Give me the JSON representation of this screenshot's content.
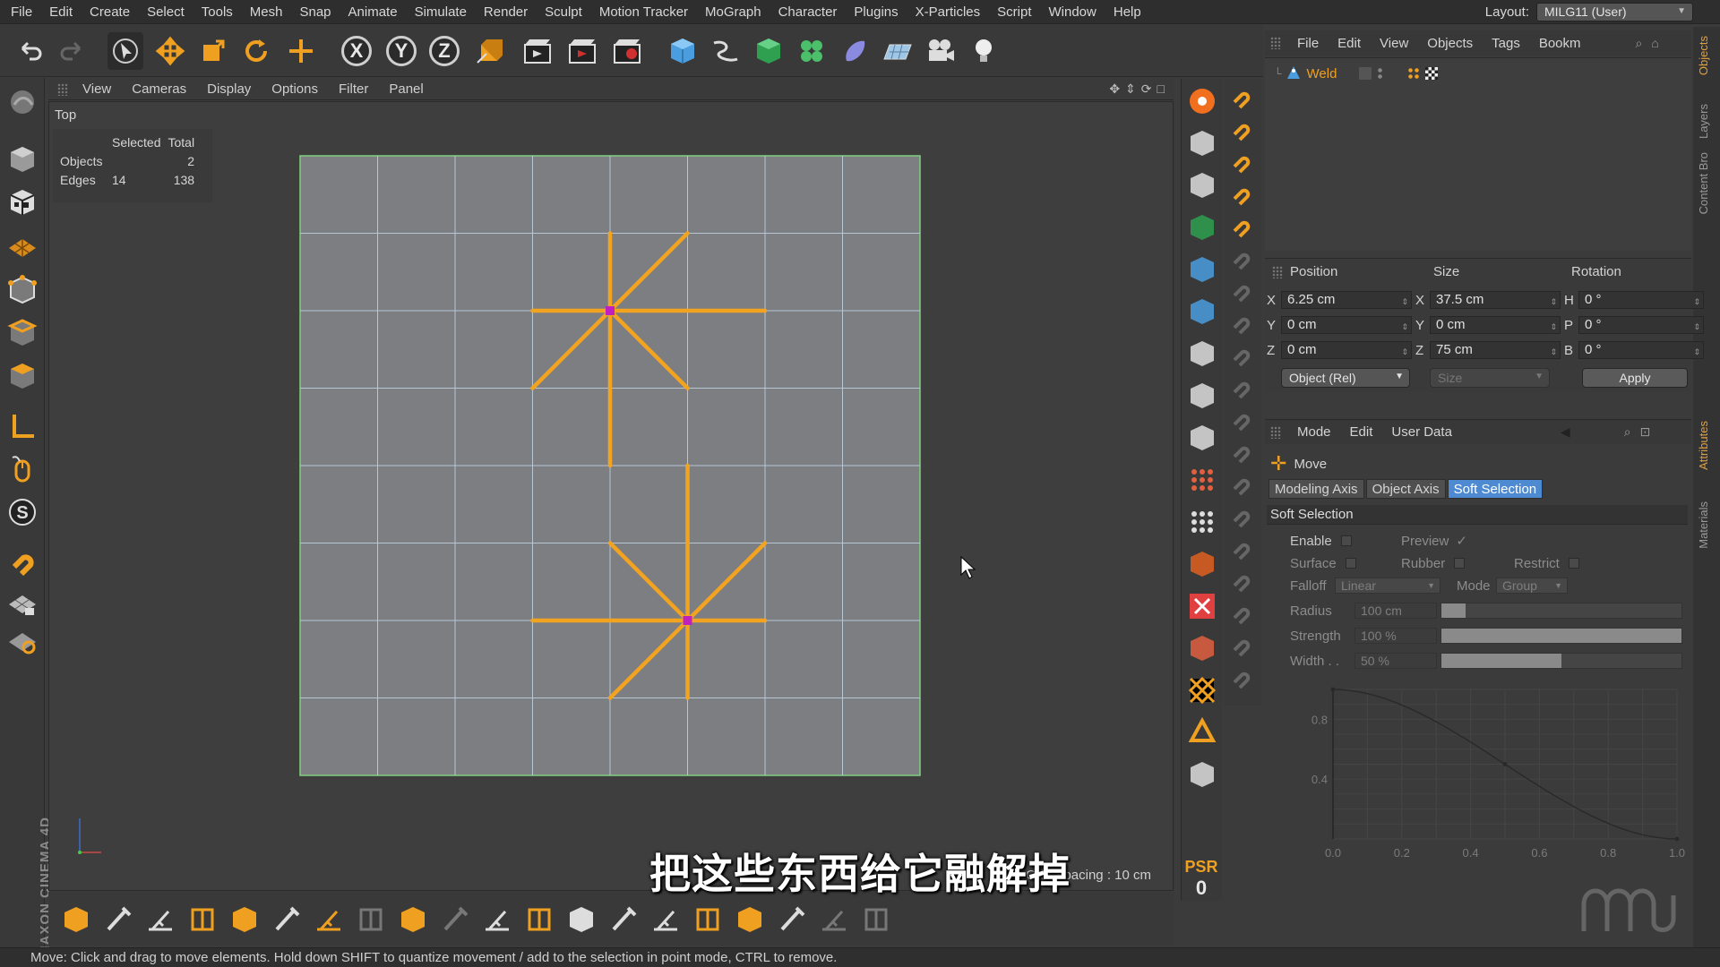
{
  "menubar": {
    "items": [
      "File",
      "Edit",
      "Create",
      "Select",
      "Tools",
      "Mesh",
      "Snap",
      "Animate",
      "Simulate",
      "Render",
      "Sculpt",
      "Motion Tracker",
      "MoGraph",
      "Character",
      "Plugins",
      "X-Particles",
      "Script",
      "Window",
      "Help"
    ],
    "layout_label": "Layout:",
    "layout_value": "MILG11 (User)"
  },
  "top_toolbar": {
    "icons": [
      "undo-icon",
      "redo-icon",
      "select-arrow-icon",
      "move-icon",
      "scale-icon",
      "rotate-icon",
      "live-select-icon",
      "x-axis-lock-icon",
      "y-axis-lock-icon",
      "z-axis-lock-icon",
      "coordinate-system-icon",
      "render-view-icon",
      "render-picture-viewer-icon",
      "render-settings-icon",
      "cube-icon",
      "pen-spline-icon",
      "subdivision-icon",
      "cloner-icon",
      "deformer-icon",
      "floor-icon",
      "camera-icon",
      "light-icon"
    ],
    "axis_labels": [
      "X",
      "Y",
      "Z"
    ]
  },
  "viewport": {
    "menu": [
      "View",
      "Cameras",
      "Display",
      "Options",
      "Filter",
      "Panel"
    ],
    "camera": "Top",
    "hud": {
      "headers": [
        "",
        "Selected",
        "Total"
      ],
      "rows": [
        {
          "label": "Objects",
          "selected": "",
          "total": "2"
        },
        {
          "label": "Edges",
          "selected": "14",
          "total": "138"
        }
      ]
    },
    "grid_spacing": "Grid Spacing : 10 cm",
    "selection_color": "#f2a31f",
    "point_color": "#c020c0",
    "plane_color": "#7c7e82"
  },
  "status_bar": {
    "text": "Move: Click and drag to move elements. Hold down SHIFT to quantize movement / add to the selection in point mode, CTRL to remove."
  },
  "brand": "MAXON CINEMA 4D",
  "psr": {
    "label": "PSR",
    "value": "0"
  },
  "object_manager": {
    "menu": [
      "File",
      "Edit",
      "View",
      "Objects",
      "Tags",
      "Bookm"
    ],
    "objects": [
      {
        "name": "Weld",
        "icon": "weld-icon"
      }
    ]
  },
  "side_tabs": [
    "Objects",
    "Layers",
    "Content Bro",
    "Attributes",
    "Materials"
  ],
  "coordinates": {
    "headers": [
      "Position",
      "Size",
      "Rotation"
    ],
    "rows": [
      {
        "pos_label": "X",
        "pos": "6.25 cm",
        "size_label": "X",
        "size": "37.5 cm",
        "rot_label": "H",
        "rot": "0 °"
      },
      {
        "pos_label": "Y",
        "pos": "0 cm",
        "size_label": "Y",
        "size": "0 cm",
        "rot_label": "P",
        "rot": "0 °"
      },
      {
        "pos_label": "Z",
        "pos": "0 cm",
        "size_label": "Z",
        "size": "75 cm",
        "rot_label": "B",
        "rot": "0 °"
      }
    ],
    "mode": "Object (Rel)",
    "size_mode": "Size",
    "apply": "Apply"
  },
  "attributes": {
    "menu": [
      "Mode",
      "Edit",
      "User Data"
    ],
    "title": "Move",
    "tabs": [
      {
        "label": "Modeling Axis",
        "active": false
      },
      {
        "label": "Object Axis",
        "active": false
      },
      {
        "label": "Soft Selection",
        "active": true
      }
    ],
    "section": "Soft Selection",
    "enable": "Enable",
    "preview": "Preview",
    "preview_check": "✓",
    "surface": "Surface",
    "rubber": "Rubber",
    "restrict": "Restrict",
    "falloff_label": "Falloff",
    "falloff_value": "Linear",
    "mode_label": "Mode",
    "mode_value": "Group",
    "radius_label": "Radius",
    "radius_value": "100 cm",
    "strength_label": "Strength",
    "strength_value": "100 %",
    "strength_level": 1.0,
    "width_label": "Width . .",
    "width_value": "50 %",
    "width_level": 0.5,
    "radius_level": 0.1
  },
  "falloff_curve": {
    "x_ticks": [
      "0.0",
      "0.2",
      "0.4",
      "0.6",
      "0.8",
      "1.0"
    ],
    "y_ticks": [
      "0.8",
      "0.4"
    ]
  },
  "subtitle": "把这些东西给它融解掉"
}
